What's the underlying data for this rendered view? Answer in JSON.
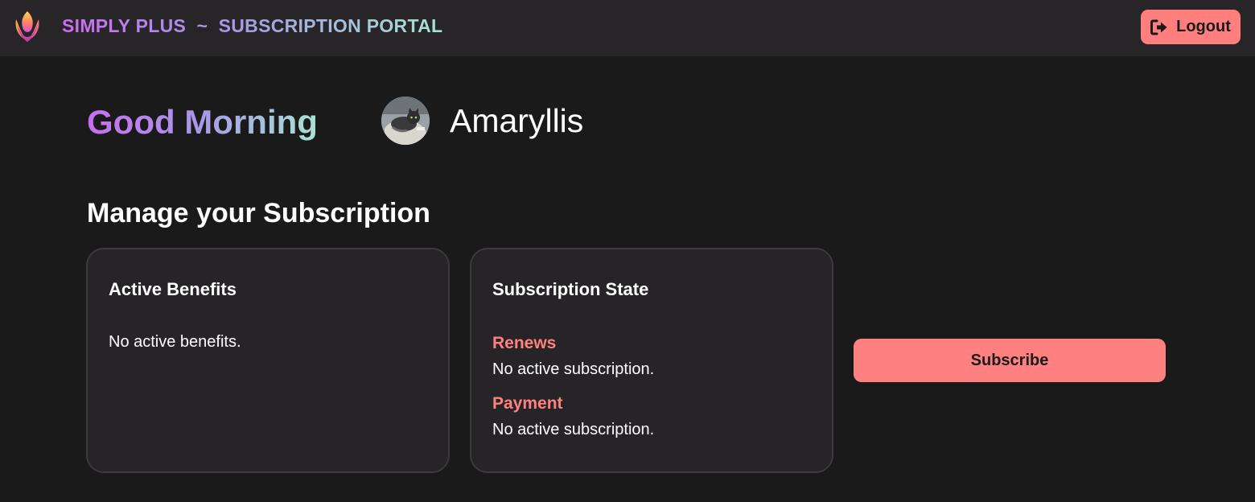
{
  "header": {
    "brand_text": "SIMPLY PLUS  ~  SUBSCRIPTION PORTAL",
    "logout_label": "Logout",
    "logo_icon": "tulip-logo-icon",
    "logout_icon": "sign-out-icon"
  },
  "greeting": {
    "text": "Good Morning",
    "username": "Amaryllis",
    "avatar_icon": "cat-avatar"
  },
  "main": {
    "section_title": "Manage your Subscription",
    "benefits_card": {
      "title": "Active Benefits",
      "empty_text": "No active benefits."
    },
    "state_card": {
      "title": "Subscription State",
      "renews_label": "Renews",
      "renews_value": "No active subscription.",
      "payment_label": "Payment",
      "payment_value": "No active subscription."
    },
    "subscribe_label": "Subscribe"
  },
  "colors": {
    "background": "#1a1a1a",
    "topbar": "#272527",
    "accent": "#ff8080",
    "gradient_start": "#c86ef0",
    "gradient_mid": "#a79ae6",
    "gradient_end": "#a6e4d2"
  }
}
